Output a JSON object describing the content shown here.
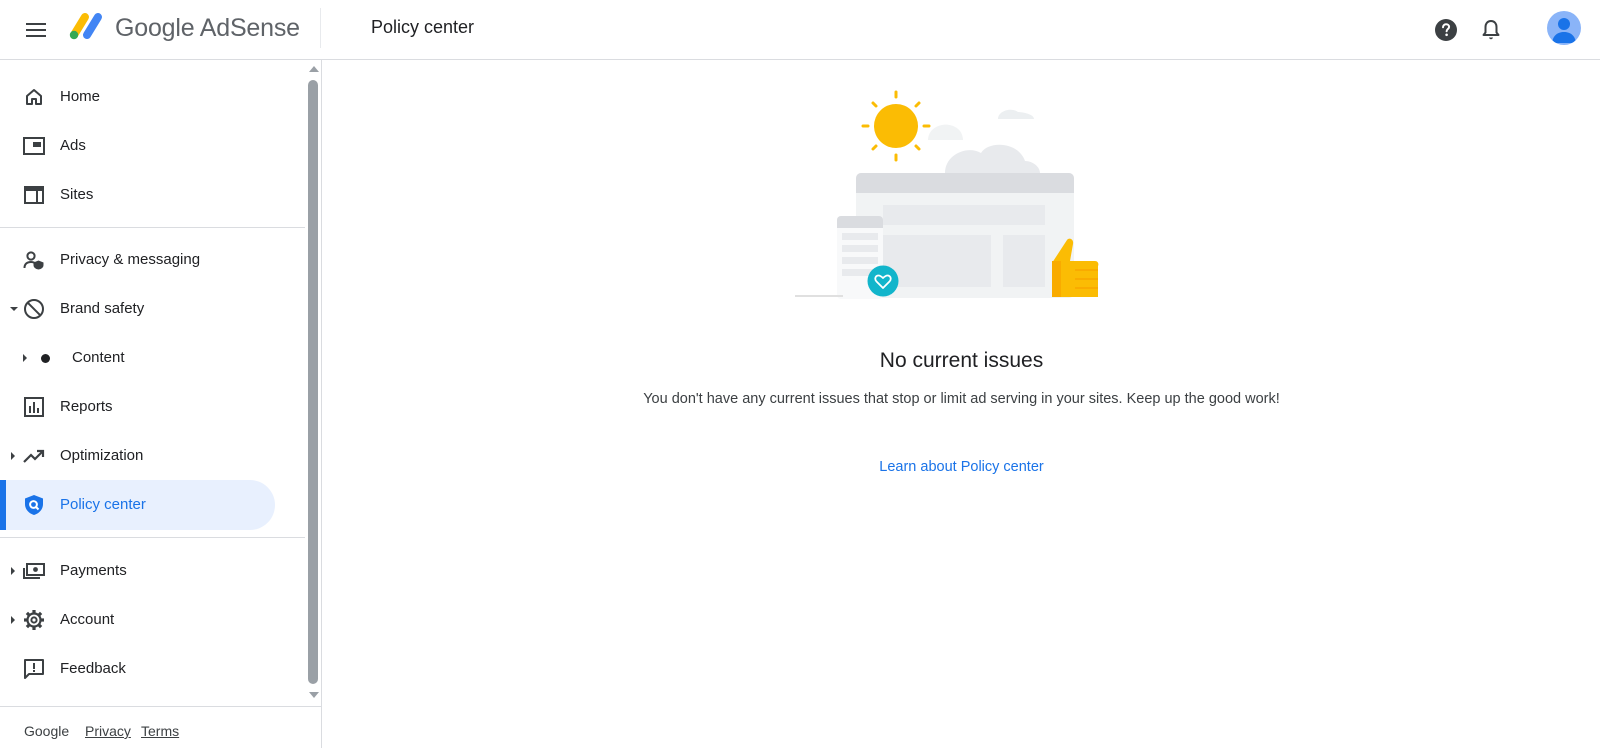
{
  "header": {
    "brand_name": "Google AdSense",
    "page_title": "Policy center",
    "menu_icon": "hamburger-menu-icon",
    "help_icon": "help-icon",
    "notifications_icon": "bell-icon",
    "avatar_icon": "account-avatar-icon"
  },
  "sidebar": {
    "items": [
      {
        "label": "Home",
        "icon": "home-icon"
      },
      {
        "label": "Ads",
        "icon": "ads-icon"
      },
      {
        "label": "Sites",
        "icon": "sites-icon"
      },
      {
        "label": "Privacy & messaging",
        "icon": "privacy-messaging-icon"
      },
      {
        "label": "Brand safety",
        "icon": "block-icon"
      },
      {
        "label": "Content",
        "icon": "dot-icon"
      },
      {
        "label": "Reports",
        "icon": "reports-icon"
      },
      {
        "label": "Optimization",
        "icon": "trending-up-icon"
      },
      {
        "label": "Policy center",
        "icon": "policy-shield-icon"
      },
      {
        "label": "Payments",
        "icon": "payments-icon"
      },
      {
        "label": "Account",
        "icon": "gear-icon"
      },
      {
        "label": "Feedback",
        "icon": "feedback-icon"
      }
    ],
    "active_item": "Policy center",
    "footer": {
      "google": "Google",
      "privacy": "Privacy",
      "terms": "Terms"
    }
  },
  "main": {
    "illustration": "no-issues-illustration",
    "title": "No current issues",
    "description": "You don't have any current issues that stop or limit ad serving in your sites. Keep up the good work!",
    "learn_link": "Learn about Policy center"
  },
  "colors": {
    "accent": "#1a73e8",
    "active_bg": "#e8f0fe",
    "logo_yellow": "#fbbc04",
    "logo_green": "#34a853",
    "logo_blue": "#4285f4",
    "sun": "#fbbc04",
    "teal": "#12b5cb"
  }
}
